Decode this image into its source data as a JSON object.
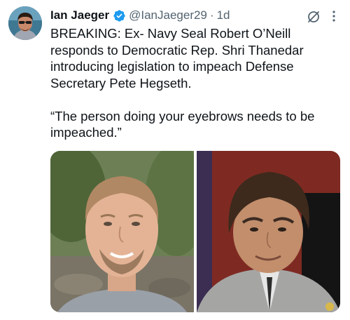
{
  "author": {
    "name": "Ian Jaeger",
    "handle": "@IanJaeger29",
    "separator": "·",
    "time": "1d",
    "verified_icon": "verified-badge-icon",
    "verified_color": "#1d9bf0"
  },
  "icons": {
    "grok": "grok-icon",
    "more": "more-options-icon"
  },
  "tweet": {
    "paragraph_1": "BREAKING: Ex- Navy Seal Robert O’Neill responds to Democratic Rep. Shri Thanedar introducing legislation to impeach Defense Secretary Pete Hegseth.",
    "paragraph_2": "“The person doing your eyebrows needs to be impeached.”"
  },
  "colors": {
    "text": "#0f1419",
    "secondary": "#536471",
    "background": "#ffffff"
  }
}
